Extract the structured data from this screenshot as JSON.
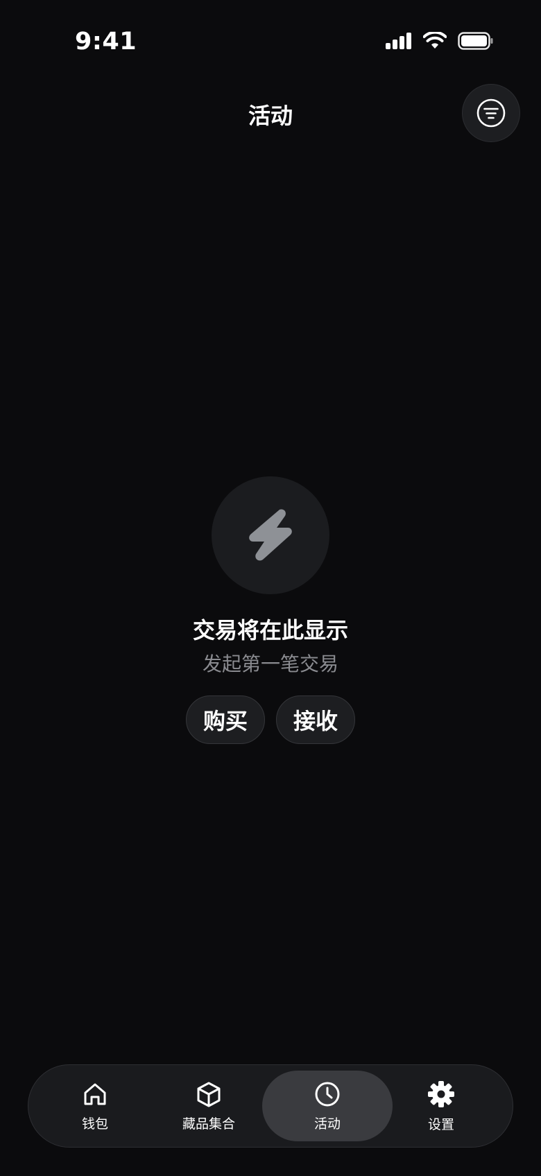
{
  "status_bar": {
    "time": "9:41",
    "icons": [
      "cellular-signal-icon",
      "wifi-icon",
      "battery-icon"
    ]
  },
  "header": {
    "title": "活动",
    "filter_icon": "filter-icon"
  },
  "empty_state": {
    "icon": "lightning-bolt-icon",
    "title": "交易将在此显示",
    "subtitle": "发起第一笔交易",
    "actions": [
      {
        "label": "购买"
      },
      {
        "label": "接收"
      }
    ]
  },
  "tab_bar": {
    "active_index": 2,
    "tabs": [
      {
        "label": "钱包",
        "icon": "home-icon"
      },
      {
        "label": "藏品集合",
        "icon": "cube-icon"
      },
      {
        "label": "活动",
        "icon": "clock-icon"
      },
      {
        "label": "设置",
        "icon": "gear-icon"
      }
    ]
  },
  "colors": {
    "background": "#0b0b0d",
    "surface": "#1d1e21",
    "active_tab": "#3a3b3f",
    "muted_text": "#8a8b90",
    "bolt_icon": "#8e9196"
  }
}
